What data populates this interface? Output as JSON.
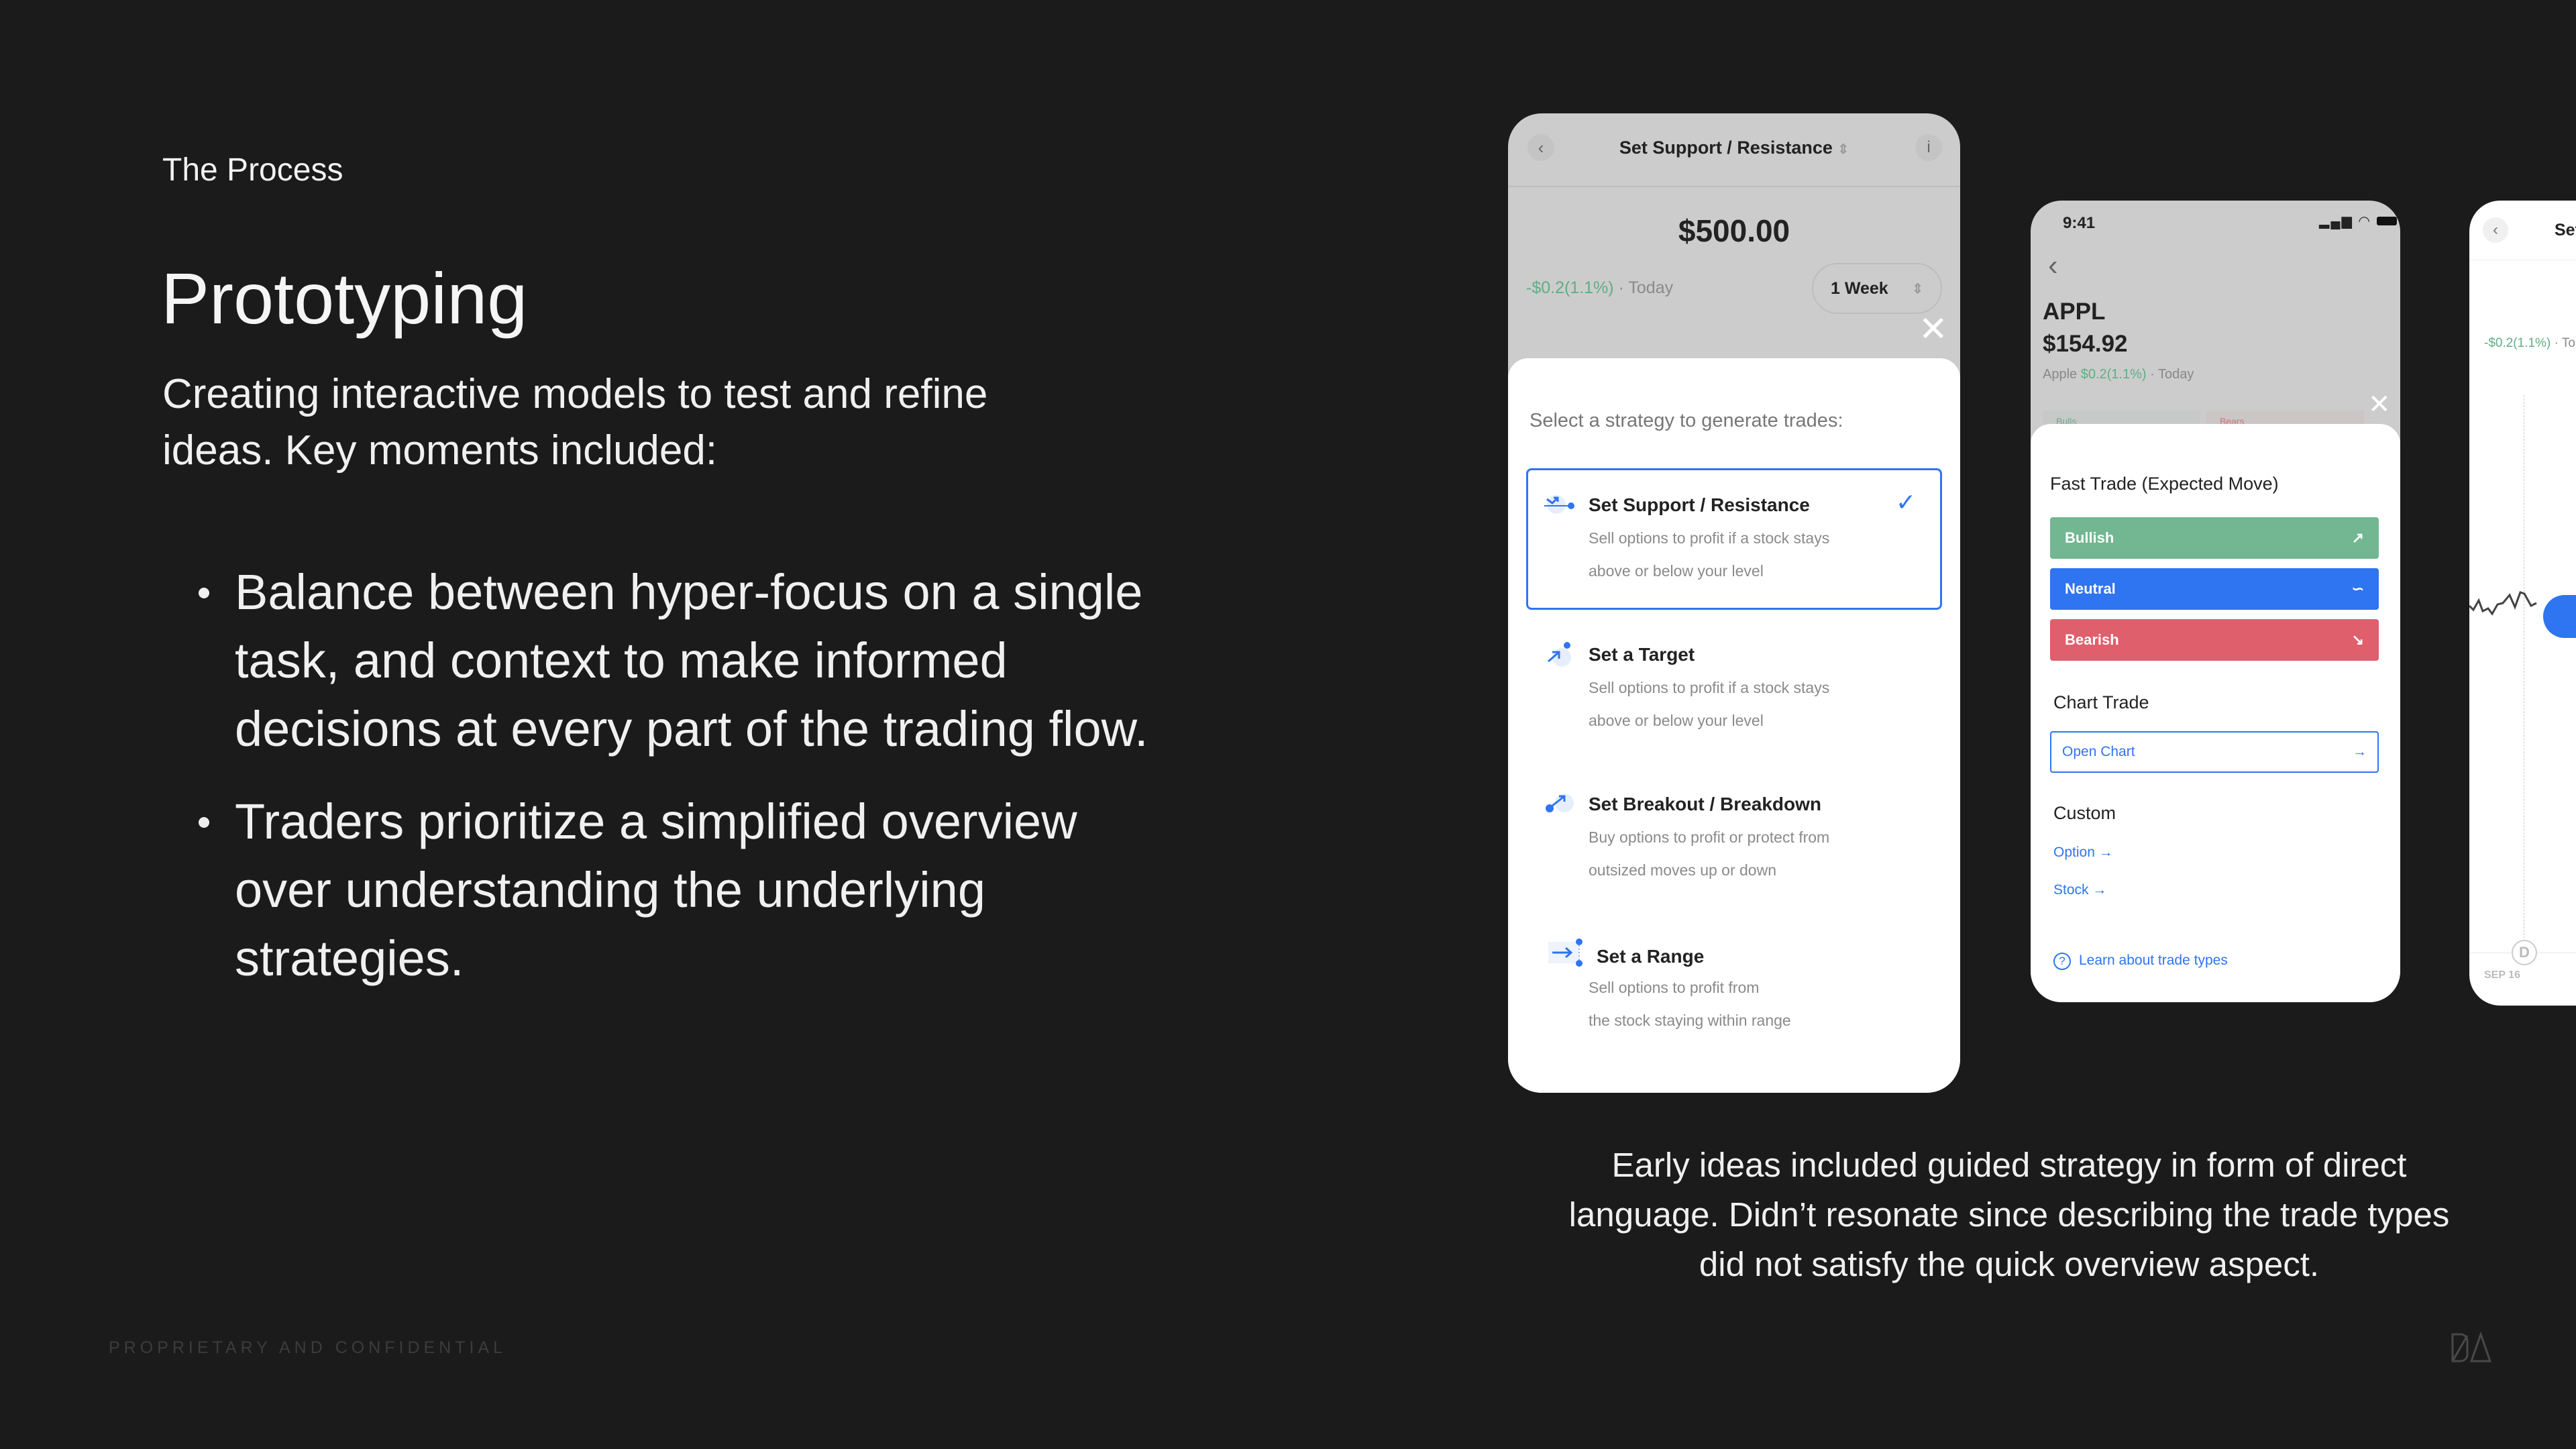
{
  "slide": {
    "kicker": "The Process",
    "title": "Prototyping",
    "subtitle": "Creating interactive models to test and refine ideas. Key moments included:",
    "bullets": [
      "Balance between hyper-focus on a single task, and context to make informed decisions at every part of the trading flow.",
      "Traders prioritize a simplified overview over understanding the underlying strategies."
    ],
    "caption": "Early ideas included guided strategy in form of direct language. Didn’t resonate since describing the trade types did not satisfy the quick overview aspect.",
    "footer": "PROPRIETARY AND CONFIDENTIAL",
    "logo": "DA"
  },
  "phone1": {
    "header_title": "Set Support / Resistance",
    "price": "$500.00",
    "change": "-$0.2(1.1%)",
    "change_suffix": " · Today",
    "period": "1 Week",
    "prompt": "Select a strategy to generate trades:",
    "strategies": [
      {
        "title": "Set Support / Resistance",
        "desc1": "Sell options to profit if a stock stays",
        "desc2": "above or below your level",
        "selected": true,
        "icon": "support-resistance-icon"
      },
      {
        "title": "Set a Target",
        "desc1": "Sell options to profit if a stock stays",
        "desc2": "above or below your level",
        "icon": "target-icon"
      },
      {
        "title": "Set Breakout / Breakdown",
        "desc1": "Buy options to profit or protect from",
        "desc2": "outsized moves up or down",
        "icon": "breakout-icon"
      },
      {
        "title": "Set a Range",
        "desc1": "Sell options to profit from",
        "desc2": "the stock staying within range",
        "icon": "range-icon"
      }
    ]
  },
  "phone2": {
    "time": "9:41",
    "ticker": "APPL",
    "price": "$154.92",
    "company": "Apple",
    "change": "$0.2(1.1%)",
    "change_suffix": " · Today",
    "bulls": "Bulls",
    "bears": "Bears",
    "fast_trade_title": "Fast Trade (Expected Move)",
    "buttons": [
      {
        "label": "Bullish",
        "color": "#72b792",
        "icon": "↗"
      },
      {
        "label": "Neutral",
        "color": "#2f74f0",
        "icon": "∽"
      },
      {
        "label": "Bearish",
        "color": "#df5f6c",
        "icon": "↘"
      }
    ],
    "chart_trade_title": "Chart Trade",
    "open_chart": "Open Chart",
    "custom_title": "Custom",
    "option": "Option",
    "stock": "Stock",
    "learn": "Learn about trade types"
  },
  "phone3": {
    "header_title": "Set",
    "change": "-$0.2(1.1%)",
    "change_suffix": " · To",
    "marker": "D",
    "date": "SEP 16"
  },
  "colors": {
    "accent": "#2f74f0",
    "positive": "#5fae84",
    "background": "#1c1b1c"
  }
}
